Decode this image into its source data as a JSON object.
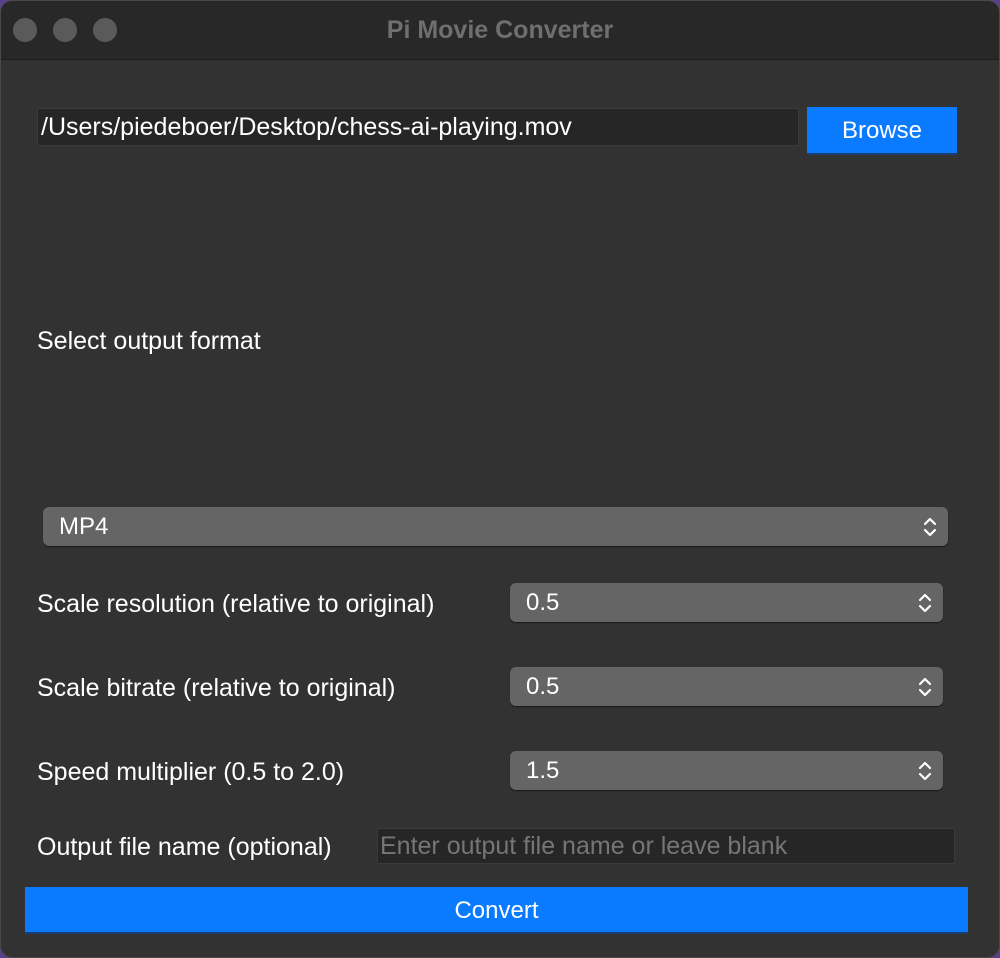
{
  "window": {
    "title": "Pi Movie Converter"
  },
  "input_file": {
    "path": "/Users/piedeboer/Desktop/chess-ai-playing.mov",
    "browse_label": "Browse"
  },
  "format": {
    "label": "Select output format",
    "selected": "MP4"
  },
  "scale_resolution": {
    "label": "Scale resolution (relative to original)",
    "selected": "0.5"
  },
  "scale_bitrate": {
    "label": "Scale bitrate (relative to original)",
    "selected": "0.5"
  },
  "speed": {
    "label": "Speed multiplier (0.5 to 2.0)",
    "selected": "1.5"
  },
  "output_name": {
    "label": "Output file name (optional)",
    "value": "",
    "placeholder": "Enter output file name or leave blank"
  },
  "convert_label": "Convert",
  "colors": {
    "accent": "#0a7bff",
    "window_bg": "#323232",
    "desktop_bg": "#5a3f8c"
  }
}
